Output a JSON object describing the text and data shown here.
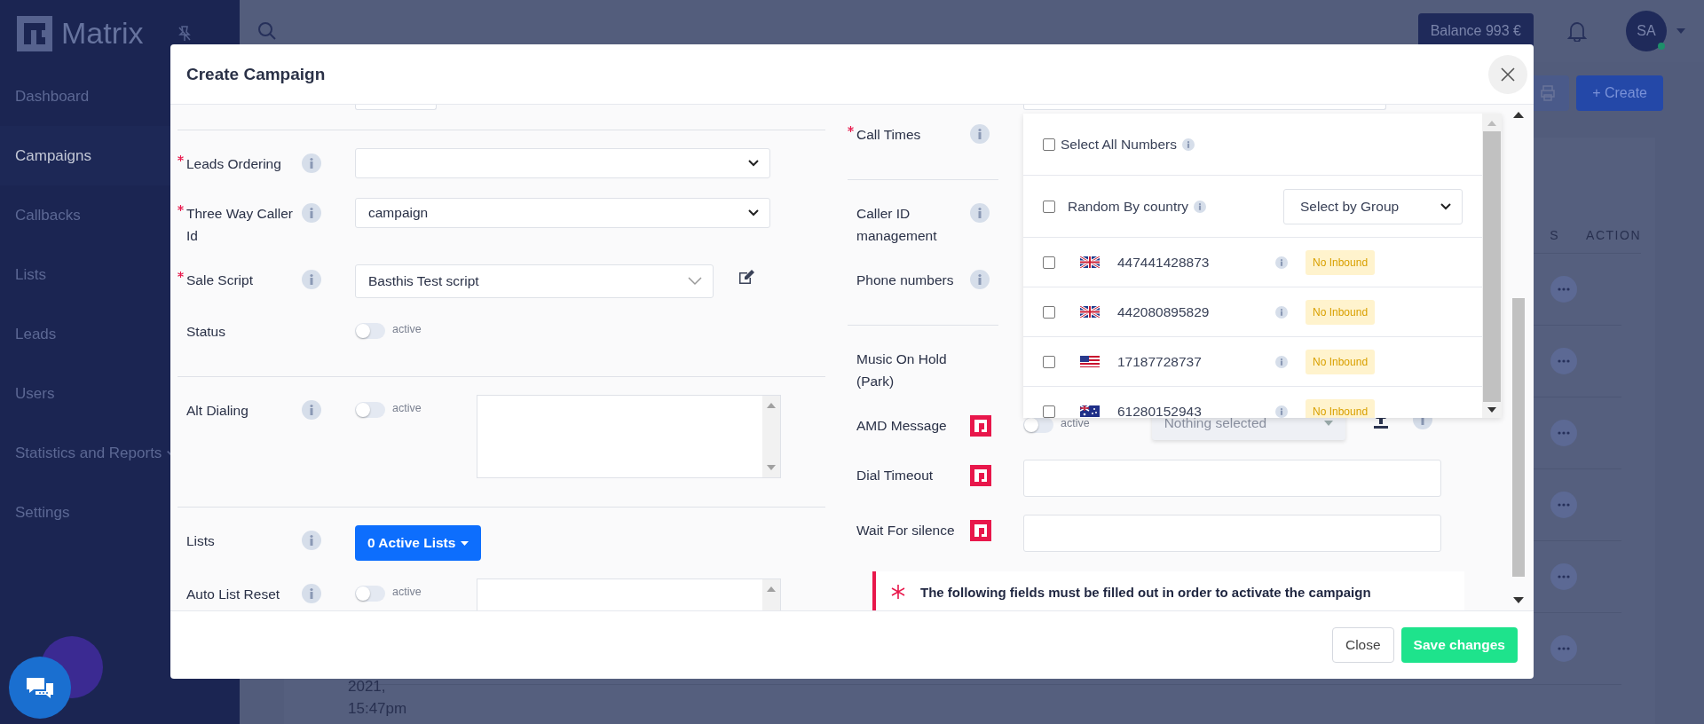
{
  "sidebar": {
    "logo": "Matrix",
    "items": [
      {
        "label": "Dashboard",
        "selected": false,
        "submenu": false
      },
      {
        "label": "Campaigns",
        "selected": true,
        "submenu": false
      },
      {
        "label": "Callbacks",
        "selected": false,
        "submenu": false
      },
      {
        "label": "Lists",
        "selected": false,
        "submenu": false
      },
      {
        "label": "Leads",
        "selected": false,
        "submenu": false
      },
      {
        "label": "Users",
        "selected": false,
        "submenu": false
      },
      {
        "label": "Statistics and Reports",
        "selected": false,
        "submenu": true
      },
      {
        "label": "Settings",
        "selected": false,
        "submenu": false
      }
    ]
  },
  "topbar": {
    "balance": "Balance 993 €",
    "avatar": "SA",
    "online": true
  },
  "page": {
    "create_button": "+ Create",
    "table": {
      "columns": [
        "S",
        "ACTION"
      ],
      "rows": [
        {},
        {},
        {},
        {},
        {},
        {
          "date": "2021, 15:47pm"
        }
      ]
    }
  },
  "modal": {
    "title": "Create Campaign",
    "left_fields": [
      {
        "kind": "select",
        "label": "Leads Ordering",
        "required": true,
        "info": true,
        "divider_before": true
      },
      {
        "kind": "select",
        "label": "Three Way Caller Id",
        "required": true,
        "info": true,
        "value": "campaign",
        "divider_before": false
      },
      {
        "kind": "select_edit",
        "label": "Sale Script",
        "required": true,
        "info": true,
        "value": "Basthis Test script",
        "divider_before": false
      },
      {
        "kind": "toggle",
        "label": "Status",
        "required": false,
        "info": false,
        "on": false,
        "toggle_label": "active",
        "divider_before": false
      },
      {
        "kind": "toggle_textarea",
        "label": "Alt Dialing",
        "required": false,
        "info": true,
        "on": false,
        "toggle_label": "active",
        "divider_before": true
      },
      {
        "kind": "dropdown_button",
        "label": "Lists",
        "required": false,
        "info": true,
        "button": "0 Active Lists",
        "divider_before": true
      },
      {
        "kind": "toggle_textarea",
        "label": "Auto List Reset",
        "required": false,
        "info": true,
        "on": false,
        "toggle_label": "active",
        "divider_before": false
      }
    ],
    "right_fields": [
      {
        "kind": "covered",
        "label": "Call Times",
        "required": true,
        "info": true,
        "brand": false,
        "divider_before": false
      },
      {
        "kind": "covered",
        "label": "Caller ID management",
        "required": false,
        "info": true,
        "brand": false,
        "divider_before": true
      },
      {
        "kind": "covered",
        "label": "Phone numbers",
        "required": false,
        "info": true,
        "brand": false,
        "divider_before": false
      },
      {
        "kind": "covered",
        "label": "Music On Hold (Park)",
        "required": false,
        "info": false,
        "brand": false,
        "divider_before": true
      },
      {
        "kind": "amd",
        "label": "AMD Message",
        "required": false,
        "info": false,
        "brand": true,
        "on": false,
        "toggle_label": "active",
        "placeholder": "Nothing selected",
        "divider_before": false
      },
      {
        "kind": "input",
        "label": "Dial Timeout",
        "required": false,
        "info": false,
        "brand": true,
        "divider_before": false
      },
      {
        "kind": "input",
        "label": "Wait For silence",
        "required": false,
        "info": false,
        "brand": true,
        "divider_before": false
      }
    ],
    "numbers_dropdown": {
      "select_all": {
        "label": "Select All Numbers",
        "checked": false
      },
      "random": {
        "label": "Random By country",
        "checked": false
      },
      "group_select": "Select by Group",
      "numbers": [
        {
          "kind": "uk",
          "number": "447441428873",
          "checked": false,
          "badge": "No Inbound"
        },
        {
          "kind": "uk",
          "number": "442080895829",
          "checked": false,
          "badge": "No Inbound"
        },
        {
          "kind": "us",
          "number": "17187728737",
          "checked": false,
          "badge": "No Inbound"
        },
        {
          "kind": "au",
          "number": "61280152943",
          "checked": false,
          "badge": "No Inbound"
        }
      ]
    },
    "alert": "The following fields must be filled out in order to activate the campaign",
    "buttons": [
      {
        "label": "Close",
        "kind": "secondary"
      },
      {
        "label": "Save changes",
        "kind": "primary"
      }
    ]
  }
}
